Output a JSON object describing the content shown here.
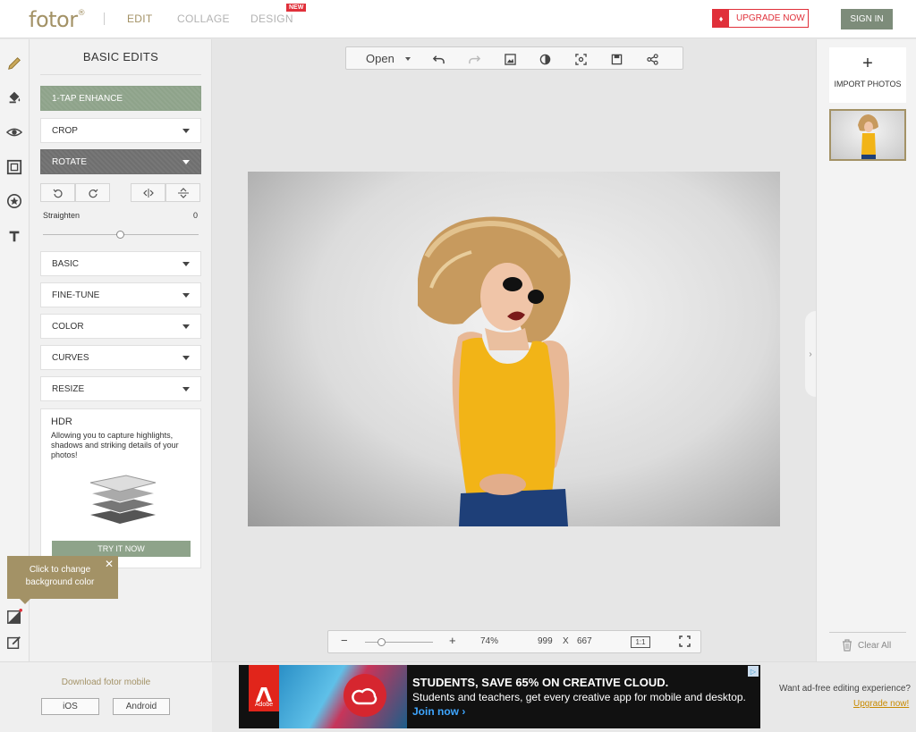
{
  "header": {
    "logo": "fotor",
    "logo_reg": "®",
    "nav": [
      {
        "label": "EDIT"
      },
      {
        "label": "COLLAGE"
      },
      {
        "label": "DESIGN"
      }
    ],
    "new_badge": "NEW",
    "upgrade_label": "UPGRADE NOW",
    "signin_label": "SIGN IN"
  },
  "rail": {
    "icons": [
      "pencil-icon",
      "paint-bucket-icon",
      "eye-icon",
      "frame-icon",
      "sticker-star-icon",
      "text-icon"
    ],
    "bottom_icons": [
      "background-color-icon",
      "edit-note-icon"
    ]
  },
  "panel": {
    "title": "BASIC EDITS",
    "enhance": "1-TAP ENHANCE",
    "crop": "CROP",
    "rotate": "ROTATE",
    "straighten_label": "Straighten",
    "straighten_value": "0",
    "straighten_fraction": 0.5,
    "items": [
      {
        "label": "BASIC"
      },
      {
        "label": "FINE-TUNE"
      },
      {
        "label": "COLOR"
      },
      {
        "label": "CURVES"
      },
      {
        "label": "RESIZE"
      }
    ],
    "hdr": {
      "title": "HDR",
      "desc": "Allowing you to capture highlights, shadows and striking details of your photos!",
      "button": "TRY IT NOW"
    }
  },
  "tooltip": {
    "text": "Click to change background color",
    "close": "✕"
  },
  "toolbar": {
    "open_label": "Open",
    "icons": [
      "undo-icon",
      "redo-icon",
      "image-icon",
      "compare-icon",
      "focus-icon",
      "save-icon",
      "share-icon"
    ]
  },
  "zoom": {
    "minus": "−",
    "plus": "+",
    "percent": "74%",
    "fraction": 0.25,
    "width": "999",
    "times": "X",
    "height": "667",
    "one_to_one": "1:1"
  },
  "right": {
    "import_plus": "+",
    "import_label": "IMPORT PHOTOS",
    "clear_all": "Clear All"
  },
  "footer": {
    "download": "Download fotor mobile",
    "ios": "iOS",
    "android": "Android",
    "ad": {
      "brand": "Adobe",
      "headline": "STUDENTS, SAVE 65% ON CREATIVE CLOUD.",
      "sub": "Students and teachers, get every creative app for mobile and desktop.",
      "cta": "Join now ›"
    },
    "adfree_text": "Want ad-free editing experience?",
    "upgrade_link": "Upgrade now!"
  },
  "colors": {
    "accent": "#a39266",
    "green": "#8ea38a",
    "red": "#e0303a"
  }
}
